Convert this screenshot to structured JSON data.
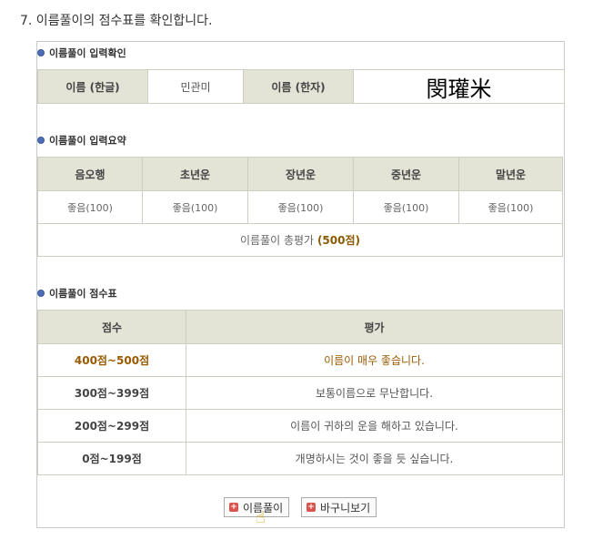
{
  "step_title": "7. 이름풀이의 점수표를 확인합니다.",
  "input_check": {
    "heading": "이름풀이 입력확인",
    "label_hangul": "이름 (한글)",
    "value_hangul": "민관미",
    "label_hanja": "이름 (한자)",
    "value_hanja": "閔瓘米"
  },
  "input_summary": {
    "heading": "이름풀이 입력요약",
    "headers": [
      "음오행",
      "초년운",
      "장년운",
      "중년운",
      "말년운"
    ],
    "values": [
      "좋음(100)",
      "좋음(100)",
      "좋음(100)",
      "좋음(100)",
      "좋음(100)"
    ],
    "total_label": "이름풀이 총평가",
    "total_value": "(500점)"
  },
  "score_table": {
    "heading": "이름풀이 점수표",
    "headers": [
      "점수",
      "평가"
    ],
    "rows": [
      {
        "range": "400점~500점",
        "desc": "이름이 매우 좋습니다."
      },
      {
        "range": "300점~399점",
        "desc": "보통이름으로 무난합니다."
      },
      {
        "range": "200점~299점",
        "desc": "이름이 귀하의 운을 해하고 있습니다."
      },
      {
        "range": "0점~199점",
        "desc": "개명하시는 것이 좋을 듯 싶습니다."
      }
    ]
  },
  "buttons": {
    "name_analysis": "이름풀이",
    "cart": "바구니보기"
  },
  "colors": {
    "header_bg": "#e3e3d6",
    "highlight": "#9a5a00",
    "bullet": "#4d6fb8",
    "button_icon": "#d9534f"
  }
}
